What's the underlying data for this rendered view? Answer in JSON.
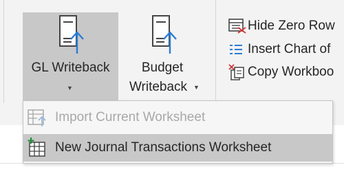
{
  "ribbon": {
    "gl_writeback": {
      "label": "GL Writeback",
      "icon": "document-upload-icon"
    },
    "budget_writeback": {
      "label_line1": "Budget",
      "label_line2": "Writeback",
      "icon": "document-upload-icon"
    },
    "small_buttons": [
      {
        "label": "Hide Zero Row",
        "icon": "hide-zero-rows-icon"
      },
      {
        "label": "Insert Chart of",
        "icon": "list-icon"
      },
      {
        "label": "Copy Workboo",
        "icon": "copy-workbook-icon"
      }
    ]
  },
  "dropdown_menu": {
    "items": [
      {
        "label": "Import Current Worksheet",
        "enabled": false,
        "icon": "import-worksheet-icon"
      },
      {
        "label": "New Journal Transactions Worksheet",
        "enabled": true,
        "icon": "new-worksheet-icon"
      }
    ]
  },
  "colors": {
    "accent_blue": "#2b7cd3",
    "pressed_gray": "#c8c8c8",
    "red_x": "#d13438",
    "green_plus": "#1e8c3a"
  }
}
